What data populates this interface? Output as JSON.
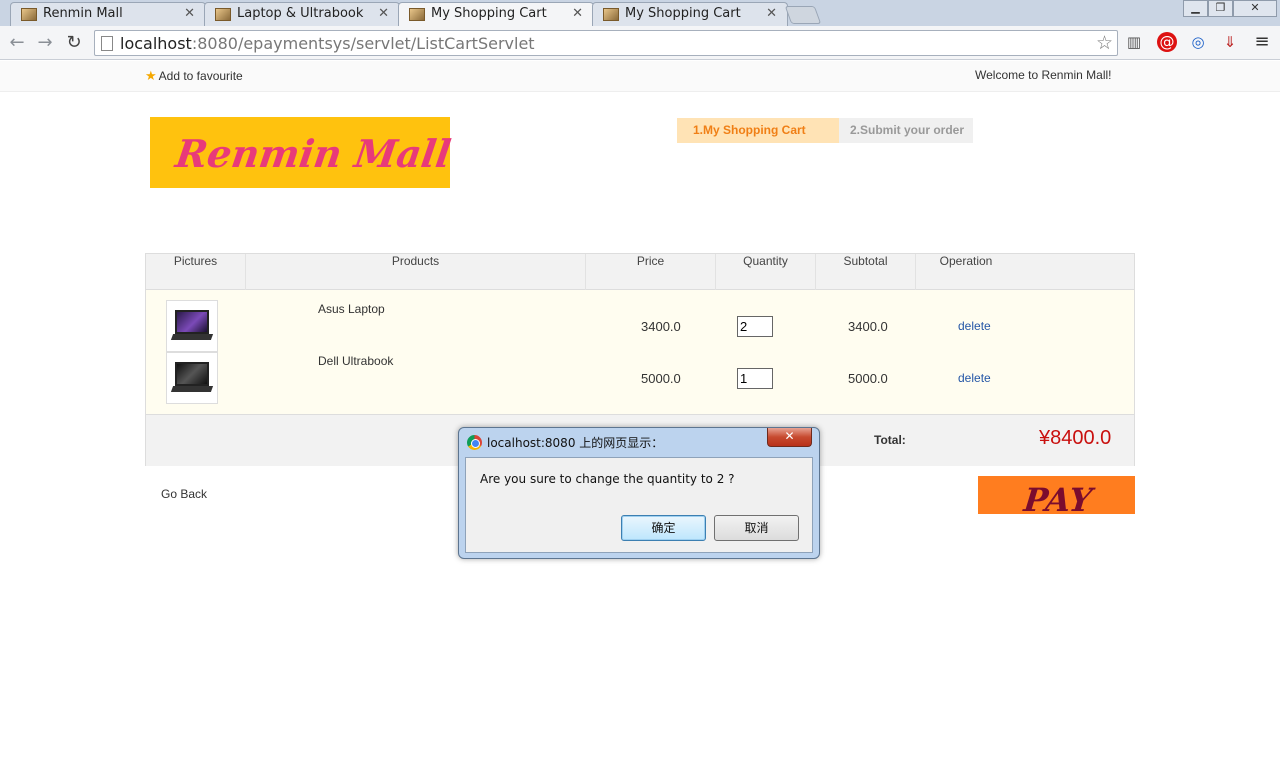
{
  "browser": {
    "tabs": [
      {
        "title": "Renmin Mall"
      },
      {
        "title": "Laptop & Ultrabook"
      },
      {
        "title": "My Shopping Cart"
      },
      {
        "title": "My Shopping Cart"
      }
    ],
    "url_host": "localhost",
    "url_rest": ":8080/epaymentsys/servlet/ListCartServlet",
    "icons": [
      "back-icon",
      "forward-icon",
      "reload-icon",
      "star-icon",
      "menu-icon"
    ]
  },
  "page": {
    "add_favourite": "Add to favourite",
    "welcome": "Welcome to Renmin Mall!",
    "logo_text": "Renmin Mall",
    "steps": [
      "1.My Shopping Cart",
      "2.Submit your order"
    ],
    "columns": [
      "Pictures",
      "Products",
      "Price",
      "Quantity",
      "Subtotal",
      "Operation"
    ],
    "items": [
      {
        "name": "Asus Laptop",
        "price": "3400.0",
        "quantity": "2",
        "subtotal": "3400.0",
        "action": "delete"
      },
      {
        "name": "Dell Ultrabook",
        "price": "5000.0",
        "quantity": "1",
        "subtotal": "5000.0",
        "action": "delete"
      }
    ],
    "total_label": "Total:",
    "total_value": "¥8400.0",
    "go_back": "Go Back",
    "pay": "PAY"
  },
  "dialog": {
    "title": "localhost:8080 上的网页显示：",
    "message": "Are you sure to change the quantity to 2 ?",
    "ok": "确定",
    "cancel": "取消",
    "close": "✕"
  }
}
